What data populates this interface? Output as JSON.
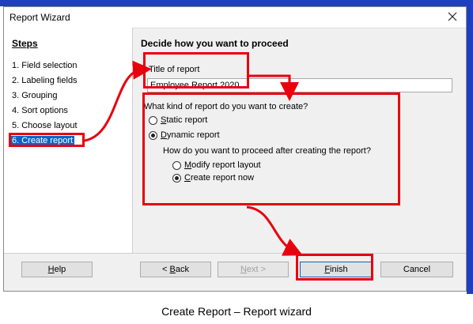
{
  "window": {
    "title": "Report Wizard",
    "close_symbol": "×"
  },
  "steps": {
    "heading": "Steps",
    "items": [
      {
        "label": "1. Field selection"
      },
      {
        "label": "2. Labeling fields"
      },
      {
        "label": "3. Grouping"
      },
      {
        "label": "4. Sort options"
      },
      {
        "label": "5. Choose layout"
      },
      {
        "label": "6. Create report",
        "active": true
      }
    ]
  },
  "main": {
    "heading": "Decide how you want to proceed",
    "title_label": "Title of report",
    "title_value": "Employee Report 2020",
    "kind_question": "What kind of report do you want to create?",
    "static_option": {
      "pre": "",
      "u": "S",
      "post": "tatic report",
      "selected": false
    },
    "dynamic_option": {
      "pre": "",
      "u": "D",
      "post": "ynamic report",
      "selected": true
    },
    "proceed_question": "How do you want to proceed after creating the report?",
    "modify_option": {
      "pre": "",
      "u": "M",
      "post": "odify report layout",
      "selected": false
    },
    "create_option": {
      "pre": "",
      "u": "C",
      "post": "reate report now",
      "selected": true
    }
  },
  "buttons": {
    "help": {
      "pre": "",
      "u": "H",
      "post": "elp"
    },
    "back": {
      "pre": "< ",
      "u": "B",
      "post": "ack"
    },
    "next": {
      "pre": "",
      "u": "N",
      "post": "ext >",
      "disabled": true
    },
    "finish": {
      "pre": "",
      "u": "F",
      "post": "inish"
    },
    "cancel": {
      "pre": "Cancel",
      "u": "",
      "post": ""
    }
  },
  "annotation_color": "#e8000d",
  "caption": "Create Report – Report wizard"
}
